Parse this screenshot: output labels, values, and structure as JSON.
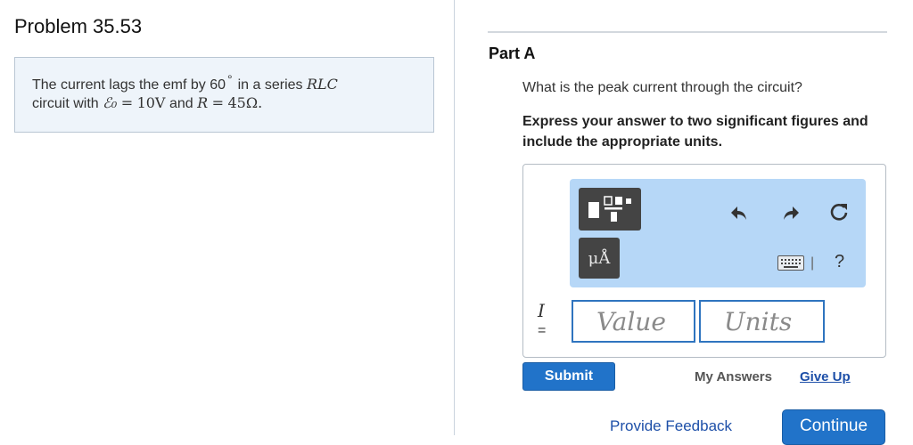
{
  "problem": {
    "title": "Problem 35.53",
    "text_part1": "The current lags the emf by 60",
    "degree": "°",
    "text_part2": "in a series",
    "rlc": "RLC",
    "line2_prefix": "circuit with",
    "emf_symbol": "ℰ₀",
    "eq1": "=",
    "emf_value": "10V",
    "and_word": "and",
    "r_symbol": "R",
    "eq2": "=",
    "r_value": "45Ω."
  },
  "part": {
    "label": "Part A",
    "question": "What is the peak current through the circuit?",
    "instruction": "Express your answer to two significant figures and include the appropriate units."
  },
  "answer": {
    "variable": "I",
    "equals": "=",
    "value_placeholder": "Value",
    "units_placeholder": "Units"
  },
  "toolbar": {
    "units_button": "μÅ",
    "undo_icon": "undo-icon",
    "redo_icon": "redo-icon",
    "reset_icon": "reset-icon",
    "keyboard_icon": "keyboard-icon",
    "separator": "|",
    "help": "?"
  },
  "actions": {
    "submit": "Submit",
    "my_answers": "My Answers",
    "give_up": "Give Up",
    "feedback": "Provide Feedback",
    "continue": "Continue"
  },
  "colors": {
    "accent": "#2173c9",
    "toolbar_bg": "#b6d7f7",
    "problem_bg": "#eef4fa",
    "link": "#1d4fa8"
  }
}
